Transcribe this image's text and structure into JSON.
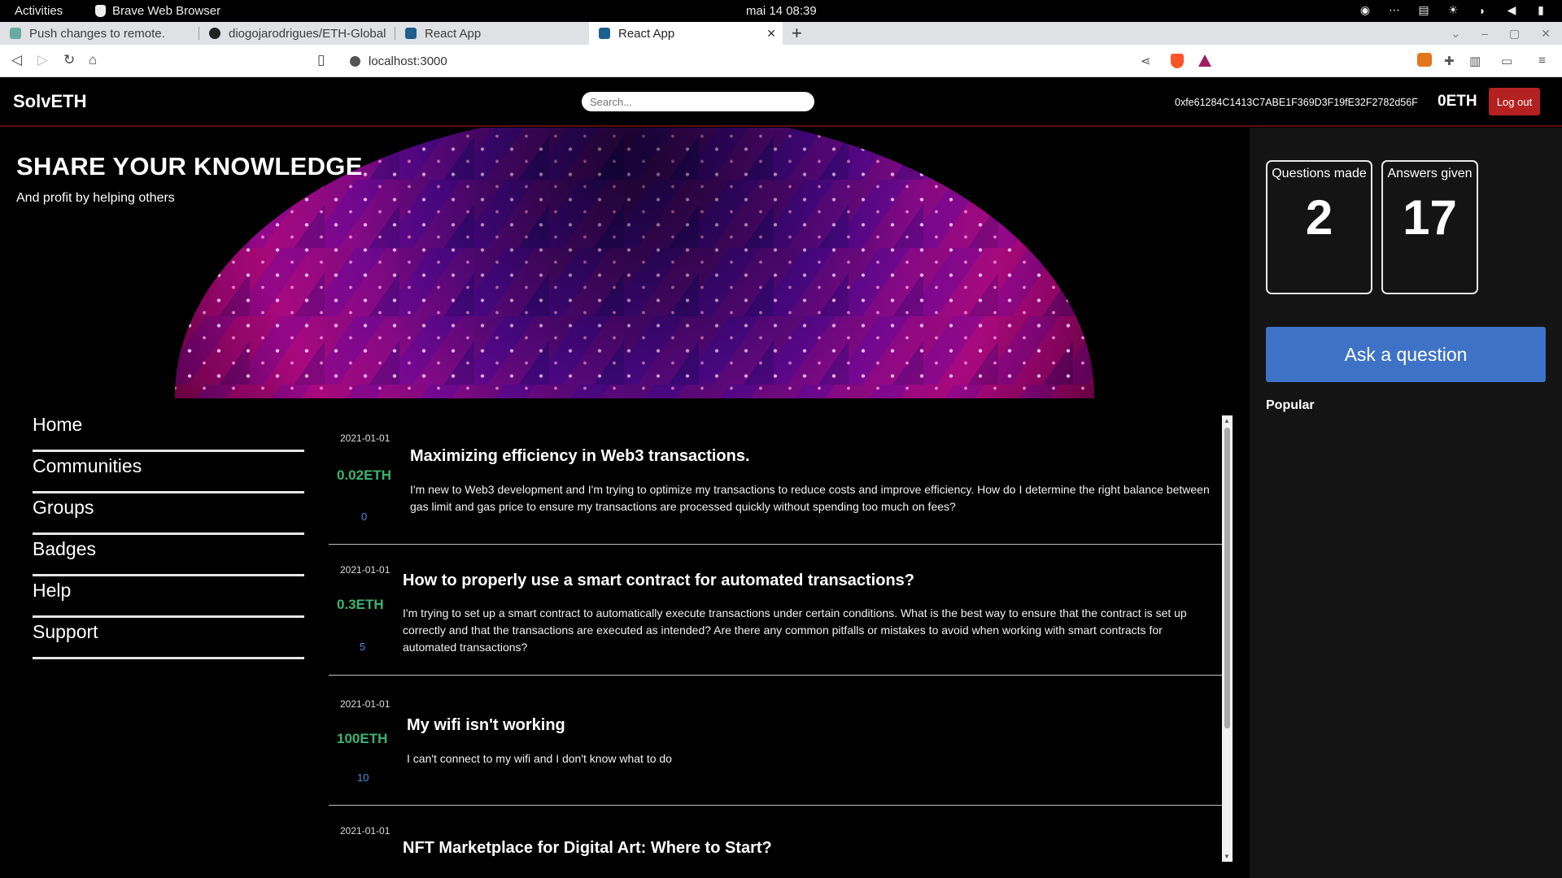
{
  "os": {
    "activities": "Activities",
    "app_name": "Brave Web Browser",
    "clock": "mai 14  08:39"
  },
  "browser": {
    "tabs": [
      {
        "label": "Push changes to remote.",
        "active": false
      },
      {
        "label": "diogojarodrigues/ETH-Global",
        "active": false
      },
      {
        "label": "React App",
        "active": false
      },
      {
        "label": "React App",
        "active": true
      }
    ],
    "url": "localhost:3000"
  },
  "header": {
    "brand": "SolvETH",
    "search_placeholder": "Search...",
    "wallet_address": "0xfe61284C1413C7ABE1F369D3F19fE32F2782d56F",
    "balance": "0ETH",
    "logout_label": "Log out"
  },
  "hero": {
    "title": "SHARE YOUR KNOWLEDGE",
    "subtitle": "And profit by helping others"
  },
  "nav": {
    "items": [
      "Home",
      "Communities",
      "Groups",
      "Badges",
      "Help",
      "Support"
    ]
  },
  "questions": [
    {
      "date": "2021-01-01",
      "reward": "0.02ETH",
      "answers": "0",
      "title": "Maximizing efficiency in Web3 transactions.",
      "body": "I'm new to Web3 development and I'm trying to optimize my transactions to reduce costs and improve efficiency. How do I determine the right balance between gas limit and gas price to ensure my transactions are processed quickly without spending too much on fees?"
    },
    {
      "date": "2021-01-01",
      "reward": "0.3ETH",
      "answers": "5",
      "title": "How to properly use a smart contract for automated transactions?",
      "body": "I'm trying to set up a smart contract to automatically execute transactions under certain conditions. What is the best way to ensure that the contract is set up correctly and that the transactions are executed as intended? Are there any common pitfalls or mistakes to avoid when working with smart contracts for automated transactions?"
    },
    {
      "date": "2021-01-01",
      "reward": "100ETH",
      "answers": "10",
      "title": "My wifi isn't working",
      "body": "I can't connect to my wifi and I don't know what to do"
    },
    {
      "date": "2021-01-01",
      "reward": "",
      "answers": "",
      "title": "NFT Marketplace for Digital Art: Where to Start?",
      "body": ""
    }
  ],
  "sidebar": {
    "questions_label": "Questions made",
    "questions_value": "2",
    "answers_label": "Answers given",
    "answers_value": "17",
    "ask_label": "Ask a question",
    "popular_label": "Popular"
  },
  "colors": {
    "reward": "#3cb371",
    "answers": "#4a90d9",
    "ask_button": "#3d72c7",
    "logout_button": "#b42121"
  }
}
